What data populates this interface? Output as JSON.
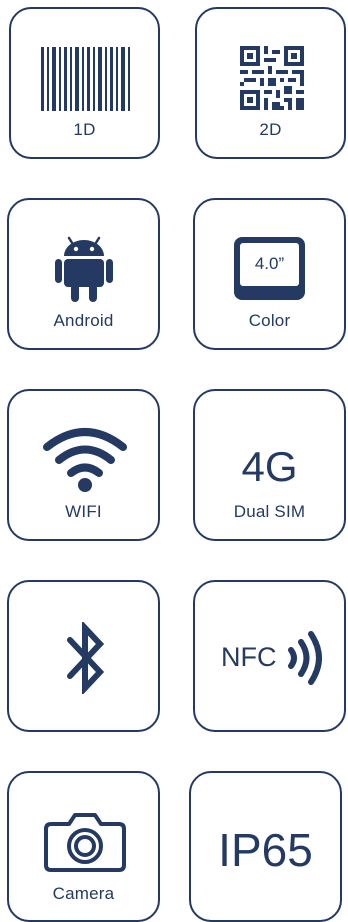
{
  "colors": {
    "stroke": "#243a63",
    "background": "#ffffff"
  },
  "tiles": [
    {
      "label": "1D",
      "icon": "barcode-icon"
    },
    {
      "label": "2D",
      "icon": "qr-code-icon"
    },
    {
      "label": "Android",
      "icon": "android-icon"
    },
    {
      "label": "Color",
      "icon": "screen-icon",
      "screen_text": "4.0”"
    },
    {
      "label": "WIFI",
      "icon": "wifi-icon"
    },
    {
      "label": "Dual SIM",
      "icon": "network-icon",
      "big_text": "4G"
    },
    {
      "label": "",
      "icon": "bluetooth-icon"
    },
    {
      "label": "",
      "icon": "nfc-icon",
      "big_text": "NFC"
    },
    {
      "label": "Camera",
      "icon": "camera-icon"
    },
    {
      "label": "",
      "icon": "ip-rating-icon",
      "big_text": "IP65"
    }
  ]
}
